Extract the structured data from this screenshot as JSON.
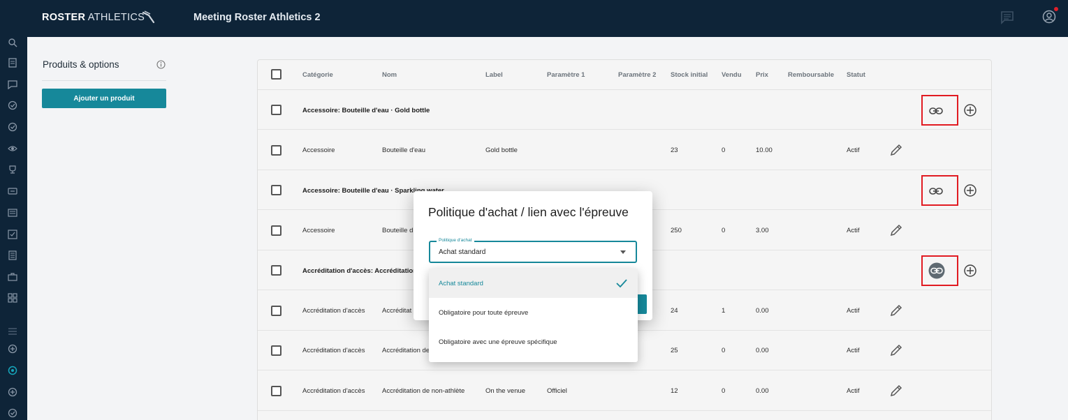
{
  "brand": {
    "bold": "ROSTER",
    "thin": " ATHLETICS"
  },
  "app_title": "Meeting Roster Athletics 2",
  "panel": {
    "title": "Produits & options",
    "add_button": "Ajouter un produit"
  },
  "table": {
    "headers": [
      "Catégorie",
      "Nom",
      "Label",
      "Paramètre 1",
      "Paramètre 2",
      "Stock initial",
      "Vendu",
      "Prix",
      "Remboursable",
      "Statut"
    ],
    "rows": [
      {
        "type": "group",
        "title": "Accessoire: Bouteille d'eau · Gold bottle"
      },
      {
        "type": "item",
        "categorie": "Accessoire",
        "nom": "Bouteille d'eau",
        "label": "Gold bottle",
        "param1": "",
        "param2": "",
        "stock": "23",
        "vendu": "0",
        "prix": "10.00",
        "remboursable": "",
        "statut": "Actif"
      },
      {
        "type": "group",
        "title": "Accessoire: Bouteille d'eau · Sparkling water"
      },
      {
        "type": "item",
        "categorie": "Accessoire",
        "nom": "Bouteille d",
        "label": "",
        "param1": "",
        "param2": "",
        "stock": "250",
        "vendu": "0",
        "prix": "3.00",
        "remboursable": "",
        "statut": "Actif"
      },
      {
        "type": "group",
        "title": "Accréditation d'accès: Accréditation"
      },
      {
        "type": "item",
        "categorie": "Accréditation d'accès",
        "nom": "Accréditat",
        "label": "",
        "param1": "",
        "param2": "",
        "stock": "24",
        "vendu": "1",
        "prix": "0.00",
        "remboursable": "",
        "statut": "Actif"
      },
      {
        "type": "item",
        "categorie": "Accréditation d'accès",
        "nom": "Accréditation de",
        "label": "",
        "param1": "",
        "param2": "",
        "stock": "25",
        "vendu": "0",
        "prix": "0.00",
        "remboursable": "",
        "statut": "Actif"
      },
      {
        "type": "item",
        "categorie": "Accréditation d'accès",
        "nom": "Accréditation de non-athlète",
        "label": "On the venue",
        "param1": "Officiel",
        "param2": "",
        "stock": "12",
        "vendu": "0",
        "prix": "0.00",
        "remboursable": "",
        "statut": "Actif"
      }
    ]
  },
  "modal": {
    "title": "Politique d'achat / lien avec l'épreuve",
    "select_label": "Politique d'achat",
    "select_value": "Achat standard",
    "options": [
      {
        "label": "Achat standard",
        "selected": true
      },
      {
        "label": "Obligatoire pour toute épreuve",
        "selected": false
      },
      {
        "label": "Obligatoire avec une épreuve spécifique",
        "selected": false
      }
    ]
  },
  "colors": {
    "topbar": "#0e2438",
    "accent": "#16889a",
    "highlight_box": "#e11b22"
  }
}
